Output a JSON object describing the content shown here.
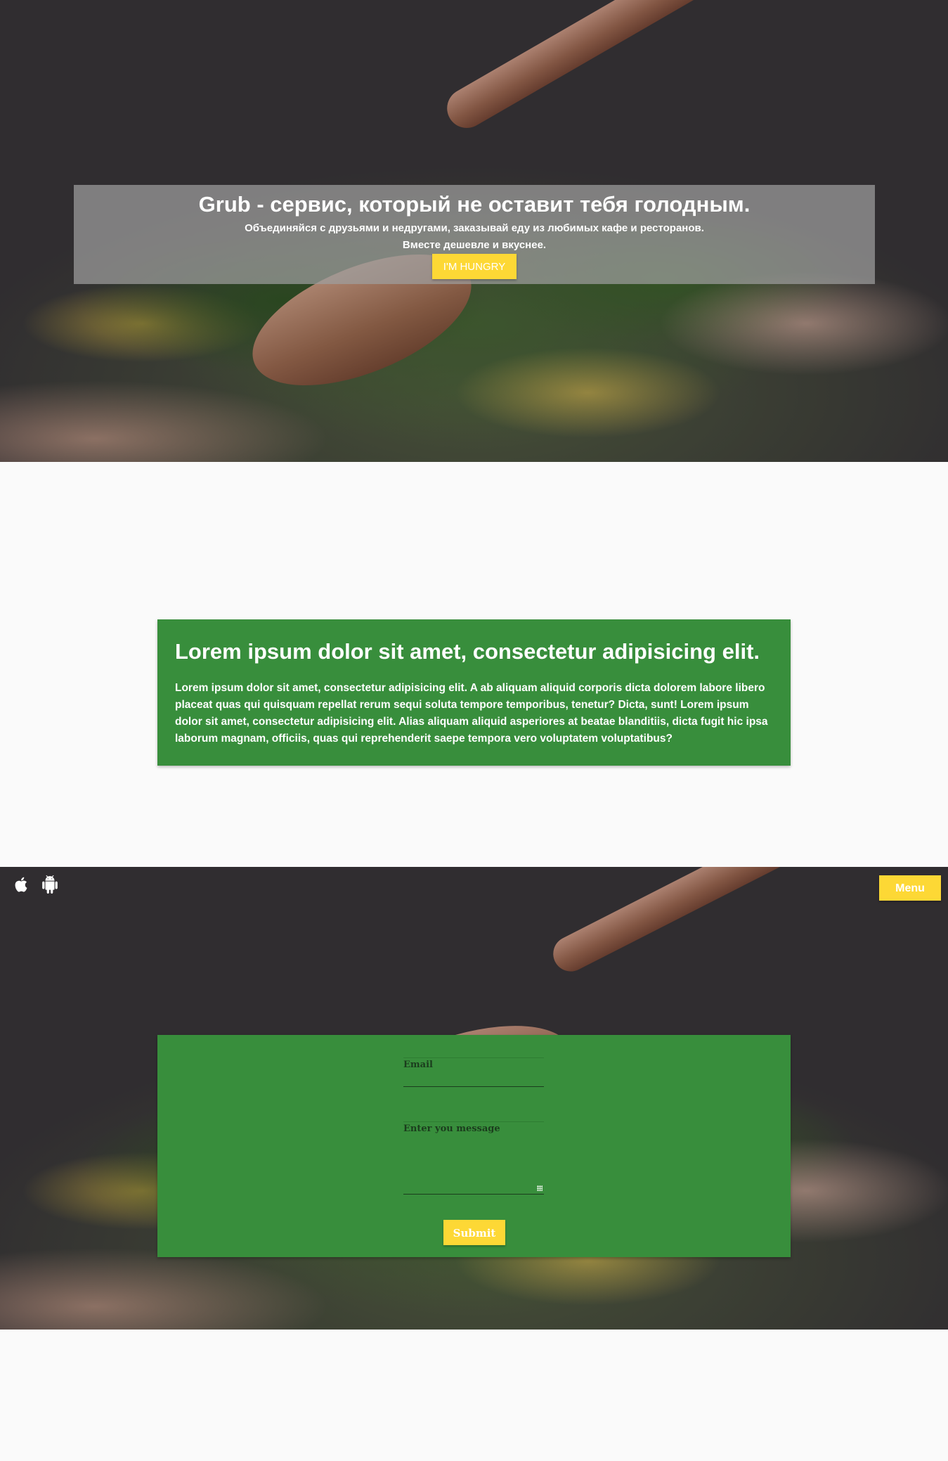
{
  "hero": {
    "title": "Grub - сервис, который не оставит тебя голодным.",
    "subtitle_line1": "Объединяйся с друзьями и недругами, заказывай еду из любимых кафе и ресторанов.",
    "subtitle_line2": "Вместе дешевле и вкуснее.",
    "cta_label": "I'M HUNGRY"
  },
  "about": {
    "heading": "Lorem ipsum dolor sit amet, consectetur adipisicing elit.",
    "body": "Lorem ipsum dolor sit amet, consectetur adipisicing elit. A ab aliquam aliquid corporis dicta dolorem labore libero placeat quas qui quisquam repellat rerum sequi soluta tempore temporibus, tenetur? Dicta, sunt! Lorem ipsum dolor sit amet, consectetur adipisicing elit. Alias aliquam aliquid asperiores at beatae blanditiis, dicta fugit hic ipsa laborum magnam, officiis, quas qui reprehenderit saepe tempora vero voluptatem voluptatibus?"
  },
  "nav": {
    "icons": [
      "apple-icon",
      "android-icon"
    ],
    "menu_label": "Menu"
  },
  "contact": {
    "email_label": "Email",
    "email_value": "",
    "message_label": "Enter you message",
    "message_value": "",
    "submit_label": "Submit"
  },
  "colors": {
    "accent_yellow": "#fdd835",
    "card_green": "#388e3c",
    "page_bg": "#fafafa"
  }
}
